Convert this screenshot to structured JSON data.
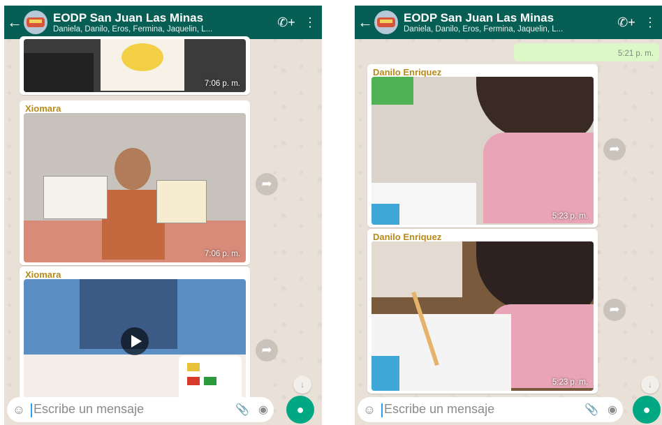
{
  "left": {
    "header": {
      "back_icon": "arrow-left-icon",
      "title": "EODP  San Juan Las Minas",
      "subtitle": "Daniela, Danilo, Eros, Fermina, Jaquelin, L...",
      "call_icon": "add-call-icon",
      "menu_icon": "more-vert-icon"
    },
    "messages": [
      {
        "sender": "",
        "time": "7:06 p. m.",
        "type": "image"
      },
      {
        "sender": "Xiomara",
        "time": "7:06 p. m.",
        "type": "image"
      },
      {
        "sender": "Xiomara",
        "time": "",
        "type": "video"
      }
    ],
    "input": {
      "placeholder": "Escribe un mensaje"
    }
  },
  "right": {
    "header": {
      "back_icon": "arrow-left-icon",
      "title": "EODP  San Juan Las Minas",
      "subtitle": "Daniela, Danilo, Eros, Fermina, Jaquelin, L...",
      "call_icon": "add-call-icon",
      "menu_icon": "more-vert-icon"
    },
    "outgoing_time": "5:21 p. m.",
    "messages": [
      {
        "sender": "Danilo Enriquez",
        "time": "5:23 p. m.",
        "type": "image"
      },
      {
        "sender": "Danilo Enriquez",
        "time": "5:23 p. m.",
        "type": "image"
      }
    ],
    "input": {
      "placeholder": "Escribe un mensaje"
    }
  },
  "colors": {
    "header": "#075e54",
    "accent": "#00a884",
    "sender": "#b58a1b",
    "wallpaper": "#e9e1d7"
  }
}
